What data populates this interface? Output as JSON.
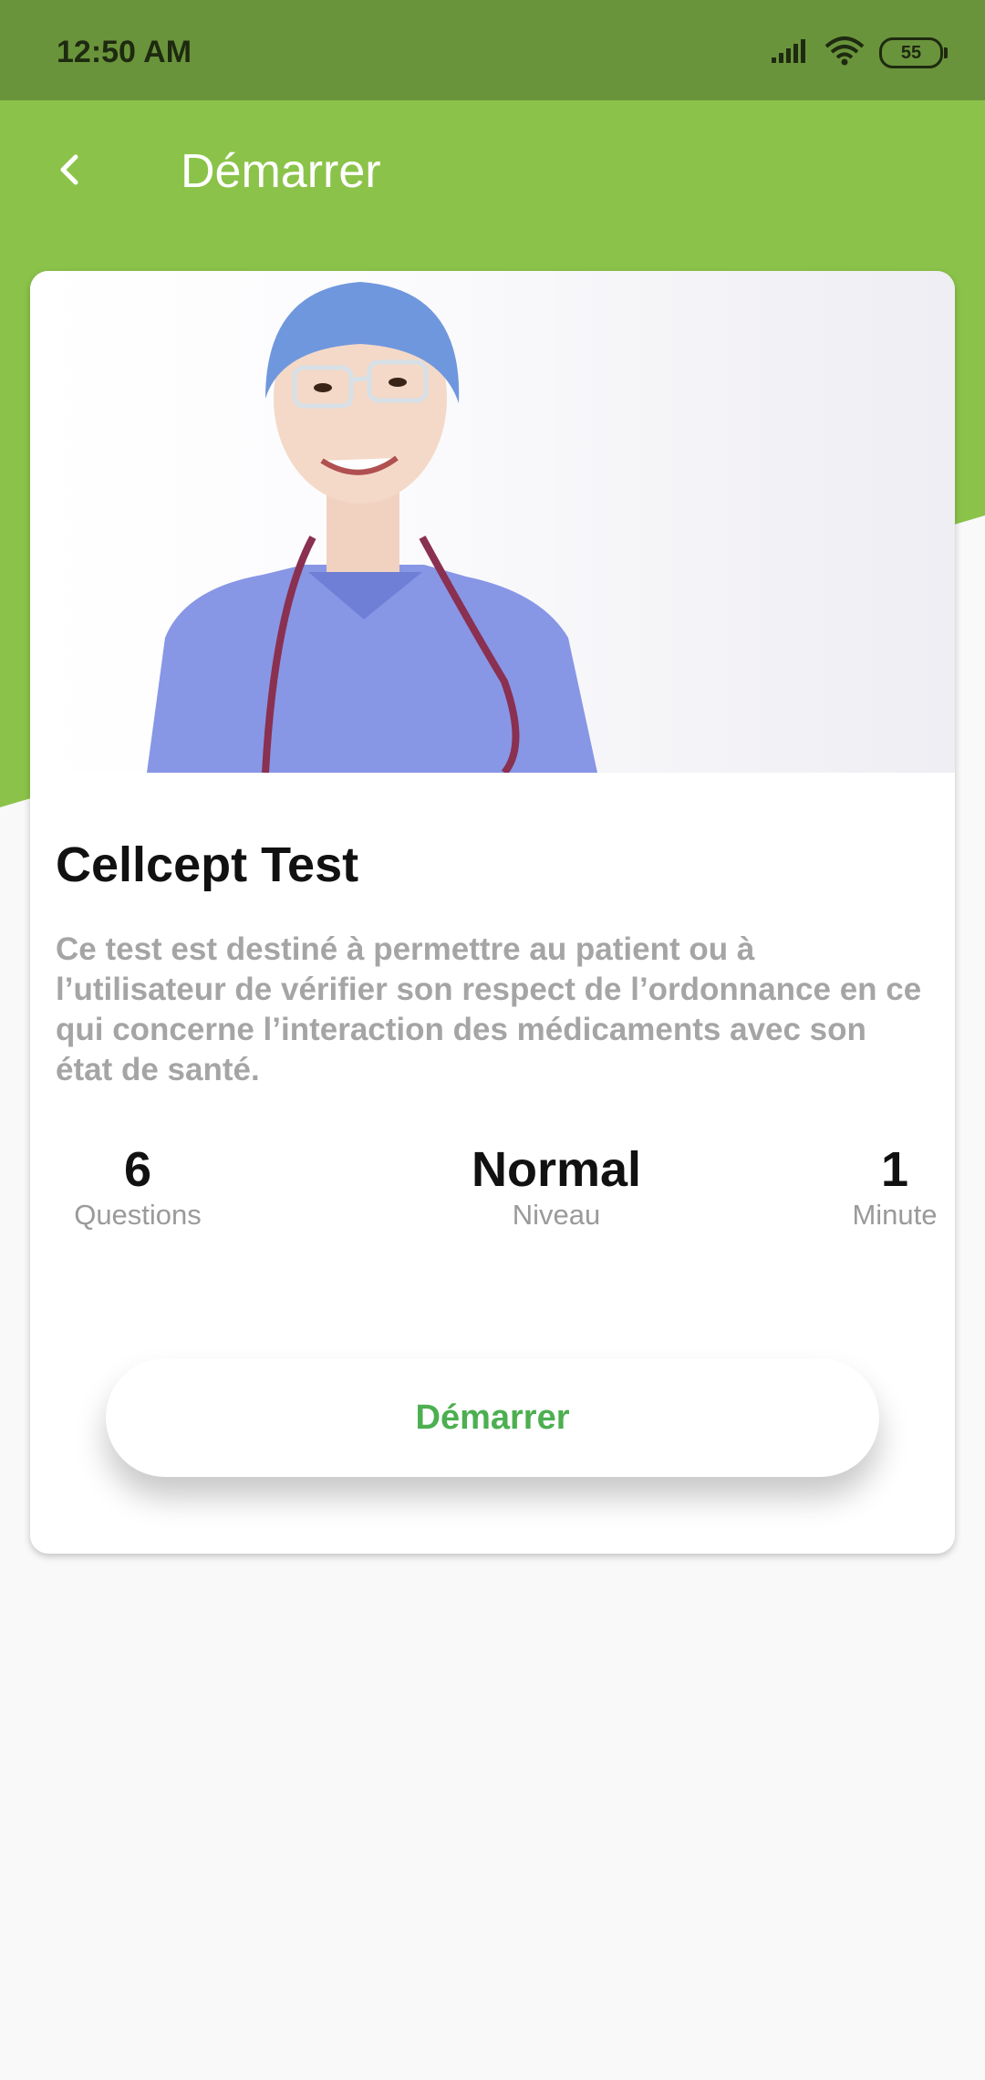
{
  "status_bar": {
    "time": "12:50 AM",
    "battery": "55",
    "icons": [
      "signal-icon",
      "wifi-icon",
      "battery-icon"
    ]
  },
  "app_bar": {
    "title": "Démarrer",
    "back_icon": "chevron-left-icon"
  },
  "quiz": {
    "title": "Cellcept Test",
    "description": "Ce test est destiné à permettre au patient ou à l’utilisateur de vérifier son respect de l’ordonnance en ce qui concerne l’interaction des médicaments avec son état de santé.",
    "stats": [
      {
        "value": "6",
        "label": "Questions"
      },
      {
        "value": "Normal",
        "label": "Niveau"
      },
      {
        "value": "1",
        "label": "Minute"
      }
    ],
    "start_label": "Démarrer"
  },
  "colors": {
    "status_bar": "#6a943b",
    "header_green": "#8bc34a",
    "button_text": "#4caf50",
    "background": "#f9f9f9"
  }
}
